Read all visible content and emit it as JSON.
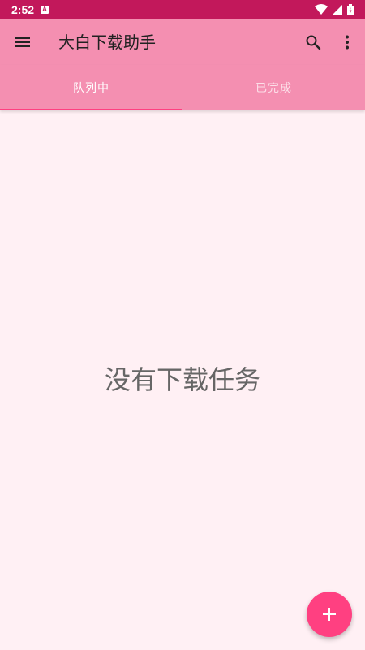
{
  "status_bar": {
    "time": "2:52",
    "notification_letter": "A",
    "icons": [
      "wifi-icon",
      "signal-icon",
      "battery-icon"
    ]
  },
  "app_bar": {
    "title": "大白下载助手",
    "icons": [
      "menu-icon",
      "search-icon",
      "more-vert-icon"
    ]
  },
  "tabs": [
    {
      "label": "队列中",
      "selected": true
    },
    {
      "label": "已完成",
      "selected": false
    }
  ],
  "main": {
    "empty_message": "没有下载任务"
  },
  "fab": {
    "icon": "plus-icon"
  },
  "colors": {
    "status_bar": "#c2185b",
    "app_bar": "#f48fb1",
    "background": "#fff0f4",
    "accent": "#ff4081"
  }
}
